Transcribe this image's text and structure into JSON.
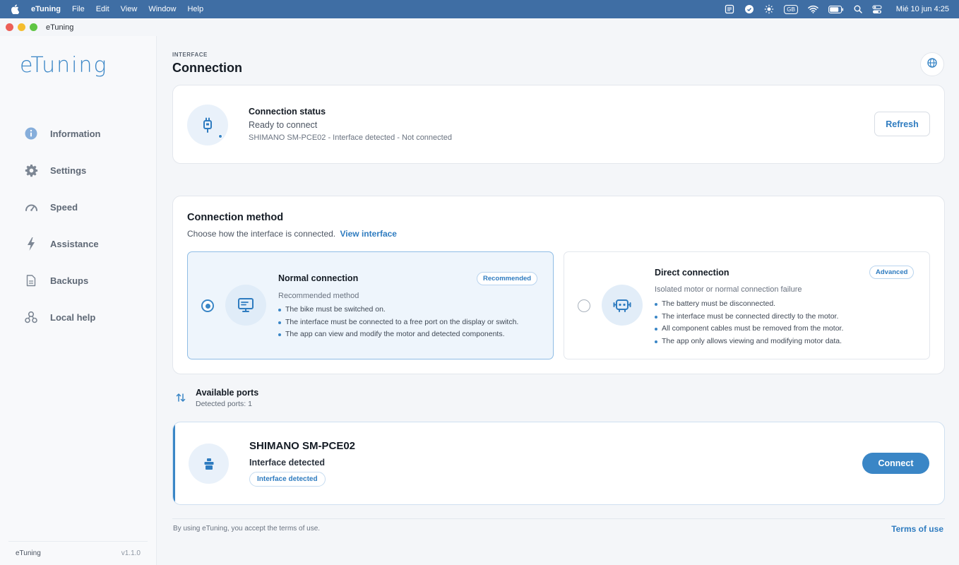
{
  "menubar": {
    "app_name": "eTuning",
    "menus": [
      "File",
      "Edit",
      "View",
      "Window",
      "Help"
    ],
    "keyboard_layout": "GB",
    "clock": "Mié 10 jun 4:25"
  },
  "window": {
    "title": "eTuning"
  },
  "sidebar": {
    "logo": "eTuning",
    "items": [
      {
        "label": "Information",
        "icon": "info-icon"
      },
      {
        "label": "Settings",
        "icon": "gear-icon"
      },
      {
        "label": "Speed",
        "icon": "speedometer-icon"
      },
      {
        "label": "Assistance",
        "icon": "lightning-icon"
      },
      {
        "label": "Backups",
        "icon": "document-icon"
      },
      {
        "label": "Local help",
        "icon": "help-nodes-icon"
      }
    ],
    "footer_app": "eTuning",
    "footer_version": "v1.1.0"
  },
  "header": {
    "eyebrow": "INTERFACE",
    "title": "Connection"
  },
  "status": {
    "title": "Connection status",
    "subtitle": "Ready to connect",
    "detail": "SHIMANO SM-PCE02 - Interface detected - Not connected",
    "refresh_label": "Refresh"
  },
  "method": {
    "title": "Connection method",
    "subtitle": "Choose how the interface is connected.",
    "link": "View interface",
    "options": [
      {
        "title": "Normal connection",
        "badge": "Recommended",
        "description": "Recommended method",
        "selected": true,
        "bullets": [
          "The bike must be switched on.",
          "The interface must be connected to a free port on the display or switch.",
          "The app can view and modify the motor and detected components."
        ]
      },
      {
        "title": "Direct connection",
        "badge": "Advanced",
        "description": "Isolated motor or normal connection failure",
        "selected": false,
        "bullets": [
          "The battery must be disconnected.",
          "The interface must be connected directly to the motor.",
          "All component cables must be removed from the motor.",
          "The app only allows viewing and modifying motor data."
        ]
      }
    ]
  },
  "ports": {
    "title": "Available ports",
    "count": "Detected ports: 1",
    "items": [
      {
        "name": "SHIMANO SM-PCE02",
        "state": "Interface detected",
        "badge": "Interface detected",
        "action": "Connect"
      }
    ]
  },
  "footer": {
    "note": "By using eTuning, you accept the terms of use.",
    "link": "Terms of use"
  },
  "colors": {
    "accent": "#3a86c6",
    "menubar": "#3f6ea4",
    "background": "#f4f6f9"
  }
}
